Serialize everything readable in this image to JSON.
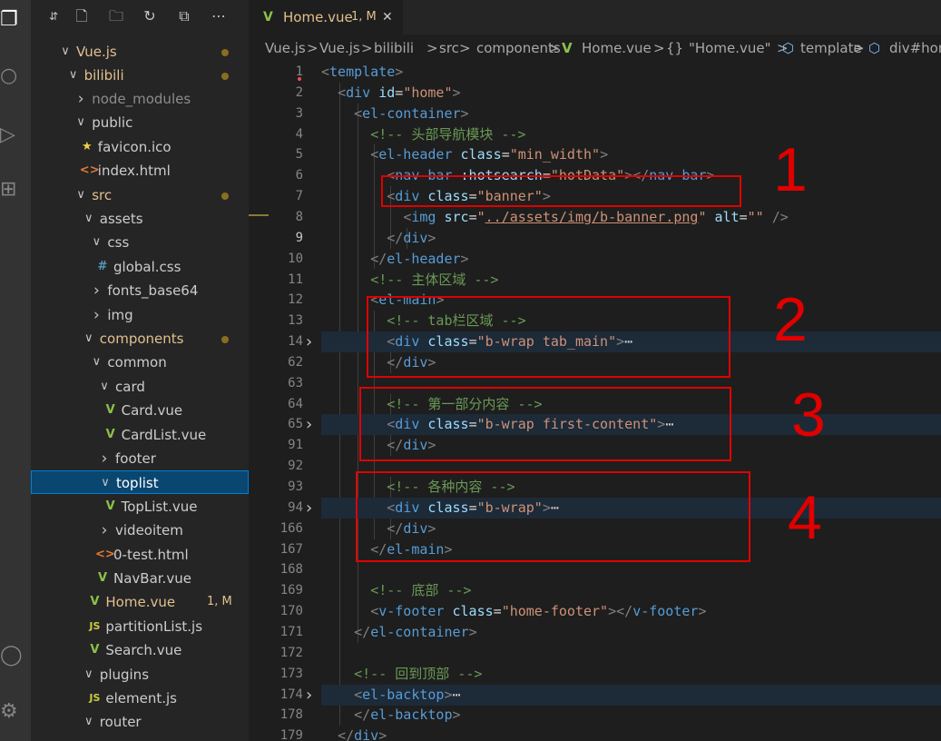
{
  "activity_bar": {
    "icons": [
      "files-icon",
      "search-icon",
      "run-debug-icon",
      "extensions-icon",
      "account-icon",
      "settings-gear-icon"
    ]
  },
  "sidebar": {
    "toolbar": [
      "new-file-icon",
      "new-folder-icon",
      "refresh-icon",
      "collapse-all-icon",
      "more-actions-icon"
    ],
    "tree": [
      {
        "label": "Vue.js",
        "depth": 0,
        "kind": "folder",
        "open": true,
        "color": "#e2c08d",
        "dot": true
      },
      {
        "label": "bilibili",
        "depth": 1,
        "kind": "folder",
        "open": true,
        "color": "#e2c08d",
        "dot": true
      },
      {
        "label": "node_modules",
        "depth": 2,
        "kind": "folder",
        "open": false,
        "color": "#8c8c8c"
      },
      {
        "label": "public",
        "depth": 2,
        "kind": "folder",
        "open": true,
        "color": "#cccccc"
      },
      {
        "label": "favicon.ico",
        "depth": 3,
        "kind": "file",
        "icon": "★",
        "icon_color": "#f1d04a",
        "color": "#cccccc"
      },
      {
        "label": "index.html",
        "depth": 3,
        "kind": "file",
        "icon": "<>",
        "icon_color": "#e37933",
        "color": "#cccccc"
      },
      {
        "label": "src",
        "depth": 2,
        "kind": "folder",
        "open": true,
        "color": "#e2c08d",
        "dot": true
      },
      {
        "label": "assets",
        "depth": 3,
        "kind": "folder",
        "open": true,
        "color": "#cccccc"
      },
      {
        "label": "css",
        "depth": 4,
        "kind": "folder",
        "open": true,
        "color": "#cccccc"
      },
      {
        "label": "global.css",
        "depth": 5,
        "kind": "file",
        "icon": "#",
        "icon_color": "#519aba",
        "color": "#cccccc"
      },
      {
        "label": "fonts_base64",
        "depth": 4,
        "kind": "folder",
        "open": false,
        "color": "#cccccc"
      },
      {
        "label": "img",
        "depth": 4,
        "kind": "folder",
        "open": false,
        "color": "#cccccc"
      },
      {
        "label": "components",
        "depth": 3,
        "kind": "folder",
        "open": true,
        "color": "#e2c08d",
        "dot": true
      },
      {
        "label": "common",
        "depth": 4,
        "kind": "folder",
        "open": true,
        "color": "#cccccc"
      },
      {
        "label": "card",
        "depth": 5,
        "kind": "folder",
        "open": true,
        "color": "#cccccc"
      },
      {
        "label": "Card.vue",
        "depth": 6,
        "kind": "file",
        "icon": "V",
        "icon_color": "#8dc149",
        "color": "#cccccc"
      },
      {
        "label": "CardList.vue",
        "depth": 6,
        "kind": "file",
        "icon": "V",
        "icon_color": "#8dc149",
        "color": "#cccccc"
      },
      {
        "label": "footer",
        "depth": 5,
        "kind": "folder",
        "open": false,
        "color": "#cccccc"
      },
      {
        "label": "toplist",
        "depth": 5,
        "kind": "folder",
        "open": true,
        "color": "#ffffff",
        "selected": true
      },
      {
        "label": "TopList.vue",
        "depth": 6,
        "kind": "file",
        "icon": "V",
        "icon_color": "#8dc149",
        "color": "#cccccc"
      },
      {
        "label": "videoitem",
        "depth": 5,
        "kind": "folder",
        "open": false,
        "color": "#cccccc"
      },
      {
        "label": "0-test.html",
        "depth": 5,
        "kind": "file",
        "icon": "<>",
        "icon_color": "#e37933",
        "color": "#cccccc"
      },
      {
        "label": "NavBar.vue",
        "depth": 5,
        "kind": "file",
        "icon": "V",
        "icon_color": "#8dc149",
        "color": "#cccccc"
      },
      {
        "label": "Home.vue",
        "depth": 4,
        "kind": "file",
        "icon": "V",
        "icon_color": "#8dc149",
        "color": "#e2c08d",
        "badge": "1, M"
      },
      {
        "label": "partitionList.js",
        "depth": 4,
        "kind": "file",
        "icon": "JS",
        "icon_color": "#cbcb41",
        "color": "#cccccc"
      },
      {
        "label": "Search.vue",
        "depth": 4,
        "kind": "file",
        "icon": "V",
        "icon_color": "#8dc149",
        "color": "#cccccc"
      },
      {
        "label": "plugins",
        "depth": 3,
        "kind": "folder",
        "open": true,
        "color": "#cccccc"
      },
      {
        "label": "element.js",
        "depth": 4,
        "kind": "file",
        "icon": "JS",
        "icon_color": "#cbcb41",
        "color": "#cccccc"
      },
      {
        "label": "router",
        "depth": 3,
        "kind": "folder",
        "open": true,
        "color": "#cccccc"
      }
    ]
  },
  "tab": {
    "icon": "V",
    "title": "Home.vue",
    "badge": "1, M",
    "close": "✕"
  },
  "breadcrumb": [
    "Vue.js",
    ">",
    "Vue.js",
    ">",
    "bilibili",
    ">",
    "src",
    ">",
    "components",
    ">",
    "V",
    "Home.vue",
    ">",
    "{}",
    "\"Home.vue\"",
    ">",
    "⬡",
    "template",
    ">",
    "⬡",
    "div#home"
  ],
  "gutter": [
    {
      "n": "1"
    },
    {
      "n": "2"
    },
    {
      "n": "3"
    },
    {
      "n": "4"
    },
    {
      "n": "5"
    },
    {
      "n": "6"
    },
    {
      "n": "7"
    },
    {
      "n": "8"
    },
    {
      "n": "9",
      "active": true
    },
    {
      "n": "10"
    },
    {
      "n": "11"
    },
    {
      "n": "12"
    },
    {
      "n": "13"
    },
    {
      "n": "14",
      "fold": true
    },
    {
      "n": "62"
    },
    {
      "n": "63"
    },
    {
      "n": "64"
    },
    {
      "n": "65",
      "fold": true
    },
    {
      "n": "91"
    },
    {
      "n": "92"
    },
    {
      "n": "93"
    },
    {
      "n": "94",
      "fold": true
    },
    {
      "n": "166"
    },
    {
      "n": "167"
    },
    {
      "n": "168"
    },
    {
      "n": "169"
    },
    {
      "n": "170"
    },
    {
      "n": "171"
    },
    {
      "n": "172"
    },
    {
      "n": "173"
    },
    {
      "n": "174",
      "fold": true
    },
    {
      "n": "178"
    },
    {
      "n": "179"
    }
  ],
  "code": [
    [
      [
        "pun",
        "<"
      ],
      [
        "tag",
        "template"
      ],
      [
        "pun",
        ">"
      ]
    ],
    [
      [
        "txt",
        "  "
      ],
      [
        "pun",
        "<"
      ],
      [
        "tag",
        "div"
      ],
      [
        "txt",
        " "
      ],
      [
        "attr",
        "id"
      ],
      [
        "txt",
        "="
      ],
      [
        "str",
        "\"home\""
      ],
      [
        "pun",
        ">"
      ]
    ],
    [
      [
        "txt",
        "    "
      ],
      [
        "pun",
        "<"
      ],
      [
        "tag",
        "el-container"
      ],
      [
        "pun",
        ">"
      ]
    ],
    [
      [
        "txt",
        "      "
      ],
      [
        "cmt",
        "<!-- 头部导航模块 -->"
      ]
    ],
    [
      [
        "txt",
        "      "
      ],
      [
        "pun",
        "<"
      ],
      [
        "tag",
        "el-header"
      ],
      [
        "txt",
        " "
      ],
      [
        "attr",
        "class"
      ],
      [
        "txt",
        "="
      ],
      [
        "str",
        "\"min_width\""
      ],
      [
        "pun",
        ">"
      ]
    ],
    [
      [
        "txt",
        "        "
      ],
      [
        "pun",
        "<"
      ],
      [
        "tag",
        "nav-bar"
      ],
      [
        "txt",
        " "
      ],
      [
        "attr",
        ":hotsearch"
      ],
      [
        "txt",
        "="
      ],
      [
        "str",
        "\"hotData\""
      ],
      [
        "pun",
        "></"
      ],
      [
        "tag",
        "nav-bar"
      ],
      [
        "pun",
        ">"
      ]
    ],
    [
      [
        "txt",
        "        "
      ],
      [
        "pun",
        "<"
      ],
      [
        "tag",
        "div"
      ],
      [
        "txt",
        " "
      ],
      [
        "attr",
        "class"
      ],
      [
        "txt",
        "="
      ],
      [
        "str",
        "\"banner\""
      ],
      [
        "pun",
        ">"
      ]
    ],
    [
      [
        "txt",
        "          "
      ],
      [
        "pun",
        "<"
      ],
      [
        "tag",
        "img"
      ],
      [
        "txt",
        " "
      ],
      [
        "attr",
        "src"
      ],
      [
        "txt",
        "="
      ],
      [
        "str",
        "\""
      ],
      [
        "url",
        "../assets/img/b-banner.png"
      ],
      [
        "str",
        "\""
      ],
      [
        "txt",
        " "
      ],
      [
        "attr",
        "alt"
      ],
      [
        "txt",
        "="
      ],
      [
        "str",
        "\"\""
      ],
      [
        "txt",
        " "
      ],
      [
        "pun",
        "/>"
      ]
    ],
    [
      [
        "txt",
        "        "
      ],
      [
        "pun",
        "</"
      ],
      [
        "tag",
        "div"
      ],
      [
        "pun",
        ">"
      ]
    ],
    [
      [
        "txt",
        "      "
      ],
      [
        "pun",
        "</"
      ],
      [
        "tag",
        "el-header"
      ],
      [
        "pun",
        ">"
      ]
    ],
    [
      [
        "txt",
        "      "
      ],
      [
        "cmt",
        "<!-- 主体区域 -->"
      ]
    ],
    [
      [
        "txt",
        "      "
      ],
      [
        "pun",
        "<"
      ],
      [
        "tag",
        "el-main"
      ],
      [
        "pun",
        ">"
      ]
    ],
    [
      [
        "txt",
        "        "
      ],
      [
        "cmt",
        "<!-- tab栏区域 -->"
      ]
    ],
    [
      [
        "txt",
        "        "
      ],
      [
        "pun",
        "<"
      ],
      [
        "tag",
        "div"
      ],
      [
        "txt",
        " "
      ],
      [
        "attr",
        "class"
      ],
      [
        "txt",
        "="
      ],
      [
        "str",
        "\"b-wrap tab_main\""
      ],
      [
        "pun",
        ">"
      ],
      [
        "txt",
        "⋯"
      ]
    ],
    [
      [
        "txt",
        "        "
      ],
      [
        "pun",
        "</"
      ],
      [
        "tag",
        "div"
      ],
      [
        "pun",
        ">"
      ]
    ],
    [],
    [
      [
        "txt",
        "        "
      ],
      [
        "cmt",
        "<!-- 第一部分内容 -->"
      ]
    ],
    [
      [
        "txt",
        "        "
      ],
      [
        "pun",
        "<"
      ],
      [
        "tag",
        "div"
      ],
      [
        "txt",
        " "
      ],
      [
        "attr",
        "class"
      ],
      [
        "txt",
        "="
      ],
      [
        "str",
        "\"b-wrap first-content\""
      ],
      [
        "pun",
        ">"
      ],
      [
        "txt",
        "⋯"
      ]
    ],
    [
      [
        "txt",
        "        "
      ],
      [
        "pun",
        "</"
      ],
      [
        "tag",
        "div"
      ],
      [
        "pun",
        ">"
      ]
    ],
    [],
    [
      [
        "txt",
        "        "
      ],
      [
        "cmt",
        "<!-- 各种内容 -->"
      ]
    ],
    [
      [
        "txt",
        "        "
      ],
      [
        "pun",
        "<"
      ],
      [
        "tag",
        "div"
      ],
      [
        "txt",
        " "
      ],
      [
        "attr",
        "class"
      ],
      [
        "txt",
        "="
      ],
      [
        "str",
        "\"b-wrap\""
      ],
      [
        "pun",
        ">"
      ],
      [
        "txt",
        "⋯"
      ]
    ],
    [
      [
        "txt",
        "        "
      ],
      [
        "pun",
        "</"
      ],
      [
        "tag",
        "div"
      ],
      [
        "pun",
        ">"
      ]
    ],
    [
      [
        "txt",
        "      "
      ],
      [
        "pun",
        "</"
      ],
      [
        "tag",
        "el-main"
      ],
      [
        "pun",
        ">"
      ]
    ],
    [],
    [
      [
        "txt",
        "      "
      ],
      [
        "cmt",
        "<!-- 底部 -->"
      ]
    ],
    [
      [
        "txt",
        "      "
      ],
      [
        "pun",
        "<"
      ],
      [
        "tag",
        "v-footer"
      ],
      [
        "txt",
        " "
      ],
      [
        "attr",
        "class"
      ],
      [
        "txt",
        "="
      ],
      [
        "str",
        "\"home-footer\""
      ],
      [
        "pun",
        "></"
      ],
      [
        "tag",
        "v-footer"
      ],
      [
        "pun",
        ">"
      ]
    ],
    [
      [
        "txt",
        "    "
      ],
      [
        "pun",
        "</"
      ],
      [
        "tag",
        "el-container"
      ],
      [
        "pun",
        ">"
      ]
    ],
    [],
    [
      [
        "txt",
        "    "
      ],
      [
        "cmt",
        "<!-- 回到顶部 -->"
      ]
    ],
    [
      [
        "txt",
        "    "
      ],
      [
        "pun",
        "<"
      ],
      [
        "tag",
        "el-backtop"
      ],
      [
        "pun",
        ">"
      ],
      [
        "txt",
        "⋯"
      ]
    ],
    [
      [
        "txt",
        "    "
      ],
      [
        "pun",
        "</"
      ],
      [
        "tag",
        "el-backtop"
      ],
      [
        "pun",
        ">"
      ]
    ],
    [
      [
        "txt",
        "  "
      ],
      [
        "pun",
        "</"
      ],
      [
        "tag",
        "div"
      ],
      [
        "pun",
        ">"
      ]
    ]
  ],
  "annotations": [
    {
      "label": "1"
    },
    {
      "label": "2"
    },
    {
      "label": "3"
    },
    {
      "label": "4"
    }
  ]
}
